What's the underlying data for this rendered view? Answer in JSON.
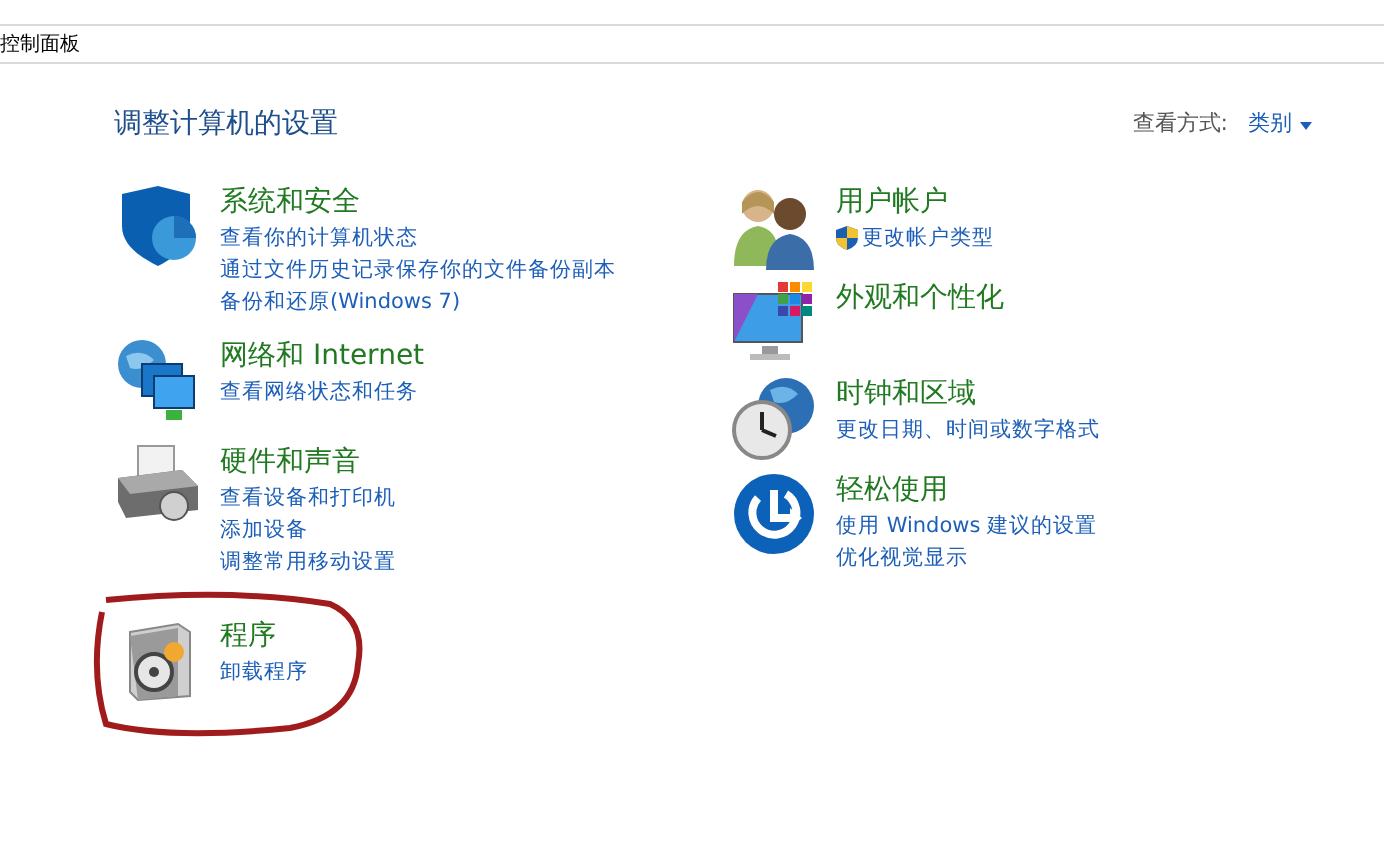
{
  "address_bar": {
    "path": "控制面板"
  },
  "heading": "调整计算机的设置",
  "view_by": {
    "label": "查看方式:",
    "value": "类别"
  },
  "columns": [
    {
      "categories": [
        {
          "kind": "security",
          "title": "系统和安全",
          "highlighted": false,
          "links": [
            {
              "text": "查看你的计算机状态",
              "shield": false
            },
            {
              "text": "通过文件历史记录保存你的文件备份副本",
              "shield": false
            },
            {
              "text": "备份和还原(Windows 7)",
              "shield": false
            }
          ]
        },
        {
          "kind": "network",
          "title": "网络和 Internet",
          "highlighted": false,
          "links": [
            {
              "text": "查看网络状态和任务",
              "shield": false
            }
          ]
        },
        {
          "kind": "hardware",
          "title": "硬件和声音",
          "highlighted": false,
          "links": [
            {
              "text": "查看设备和打印机",
              "shield": false
            },
            {
              "text": "添加设备",
              "shield": false
            },
            {
              "text": "调整常用移动设置",
              "shield": false
            }
          ]
        },
        {
          "kind": "programs",
          "title": "程序",
          "highlighted": true,
          "links": [
            {
              "text": "卸载程序",
              "shield": false
            }
          ]
        }
      ]
    },
    {
      "categories": [
        {
          "kind": "users",
          "title": "用户帐户",
          "highlighted": false,
          "links": [
            {
              "text": "更改帐户类型",
              "shield": true
            }
          ]
        },
        {
          "kind": "appearance",
          "title": "外观和个性化",
          "highlighted": false
        },
        {
          "kind": "clock",
          "title": "时钟和区域",
          "highlighted": false,
          "links": [
            {
              "text": "更改日期、时间或数字格式",
              "shield": false
            }
          ]
        },
        {
          "kind": "ease",
          "title": "轻松使用",
          "highlighted": false,
          "links": [
            {
              "text": "使用 Windows 建议的设置",
              "shield": false
            },
            {
              "text": "优化视觉显示",
              "shield": false
            }
          ]
        }
      ]
    }
  ]
}
